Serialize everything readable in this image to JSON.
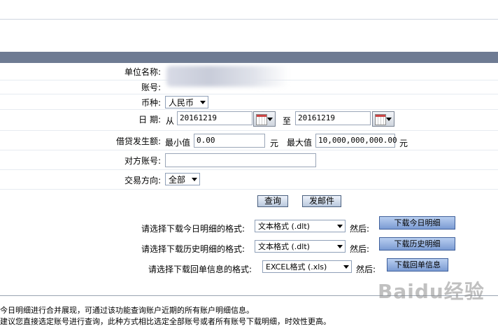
{
  "form": {
    "unit_name_label": "单位名称:",
    "account_label": "账号:",
    "currency_label": "币种:",
    "currency_value": "人民币",
    "date_label": "日  期:",
    "from_label": "从",
    "date_from": "20161219",
    "to_label": "至",
    "date_to": "20161219",
    "amount_label": "借贷发生额:",
    "min_label": "最小值",
    "min_value": "0.00",
    "yuan": "元",
    "max_label": "最大值",
    "max_value": "10,000,000,000.00",
    "counter_account_label": "对方账号:",
    "counter_account_value": "",
    "direction_label": "交易方向:",
    "direction_value": "全部"
  },
  "actions": {
    "query": "查询",
    "send_mail": "发邮件"
  },
  "downloads": {
    "today_prompt": "请选择下载今日明细的格式:",
    "today_format": "文本格式 (.dlt)",
    "then": "然后:",
    "today_button": "下载今日明细",
    "history_prompt": "请选择下载历史明细的格式:",
    "history_format": "文本格式 (.dlt)",
    "history_button": "下载历史明细",
    "receipt_prompt": "请选择下载回单信息的格式:",
    "receipt_format": "EXCEL格式 (.xls)",
    "receipt_button": "下载回单信息"
  },
  "notes": {
    "line1": "今日明细进行合并展现，可通过该功能查询账户近期的所有账户明细信息。",
    "line2": "建议您直接选定账号进行查询，此种方式相比选定全部账号或者所有账号下载明细，时效性更高。"
  },
  "watermark": "Baidu经验",
  "colors": {
    "header_bar": "#6e7b93",
    "button_blue": "#7b9bd3"
  }
}
